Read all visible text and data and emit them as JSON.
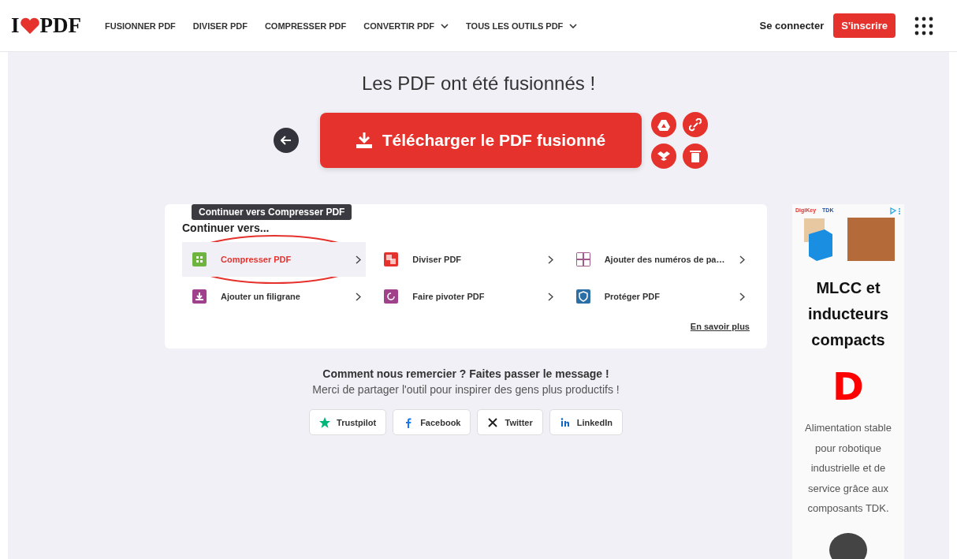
{
  "header": {
    "logo": {
      "left": "I",
      "right": "PDF"
    },
    "nav": [
      {
        "label": "FUSIONNER PDF",
        "dropdown": false
      },
      {
        "label": "DIVISER PDF",
        "dropdown": false
      },
      {
        "label": "COMPRESSER PDF",
        "dropdown": false
      },
      {
        "label": "CONVERTIR PDF",
        "dropdown": true
      },
      {
        "label": "TOUS LES OUTILS PDF",
        "dropdown": true
      }
    ],
    "login": "Se connecter",
    "signup": "S'inscrire"
  },
  "title": "Les PDF ont été fusionnés !",
  "download_button": "Télécharger le PDF fusionné",
  "side_actions": [
    {
      "kind": "drive"
    },
    {
      "kind": "link"
    },
    {
      "kind": "dropbox"
    },
    {
      "kind": "trash"
    }
  ],
  "continue_card": {
    "heading": "Continuer vers...",
    "tooltip": "Continuer vers Compresser PDF",
    "tools": [
      {
        "label": "Compresser PDF",
        "kind": "compress",
        "color": "#6fb43f",
        "selected": true
      },
      {
        "label": "Diviser PDF",
        "kind": "split",
        "color": "#e5322d",
        "selected": false
      },
      {
        "label": "Ajouter des numéros de pa…",
        "kind": "numbers",
        "color": "#a45a8b",
        "selected": false
      },
      {
        "label": "Ajouter un filigrane",
        "kind": "watermark",
        "color": "#a0418b",
        "selected": false
      },
      {
        "label": "Faire pivoter PDF",
        "kind": "rotate",
        "color": "#a0418b",
        "selected": false
      },
      {
        "label": "Protéger PDF",
        "kind": "protect",
        "color": "#2c6fa6",
        "selected": false
      }
    ],
    "more_link": "En savoir plus"
  },
  "share": {
    "heading": "Comment nous remercier ? Faites passer le message !",
    "subtitle": "Merci de partager l'outil pour inspirer des gens plus productifs !",
    "buttons": [
      {
        "label": "Trustpilot",
        "kind": "trustpilot"
      },
      {
        "label": "Facebook",
        "kind": "facebook"
      },
      {
        "label": "Twitter",
        "kind": "x"
      },
      {
        "label": "LinkedIn",
        "kind": "linkedin"
      }
    ]
  },
  "ad": {
    "brands": [
      "DigiKey",
      "TDK"
    ],
    "headline": "MLCC et inducteurs compacts",
    "logo_letter": "D",
    "body": "Alimentation stable pour robotique industrielle et de service grâce aux composants TDK."
  }
}
